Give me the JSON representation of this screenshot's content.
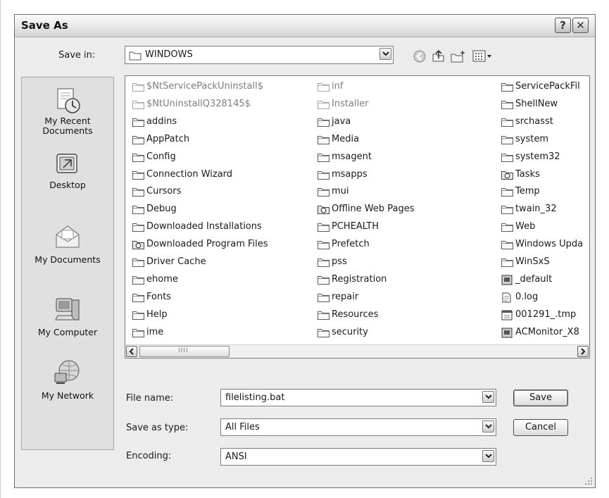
{
  "window": {
    "title": "Save As",
    "help_label": "?",
    "close_label": "✕"
  },
  "save_in": {
    "label": "Save in:",
    "value": "WINDOWS"
  },
  "toolbar": {
    "icons": [
      "back-icon",
      "up-folder-icon",
      "new-folder-icon",
      "views-menu-icon"
    ]
  },
  "places": [
    {
      "label": "My Recent Documents",
      "icon": "recent-documents-icon"
    },
    {
      "label": "Desktop",
      "icon": "desktop-icon"
    },
    {
      "label": "My Documents",
      "icon": "my-documents-icon"
    },
    {
      "label": "My Computer",
      "icon": "my-computer-icon"
    },
    {
      "label": "My Network",
      "icon": "my-network-icon"
    }
  ],
  "files": {
    "col1": [
      {
        "name": "$NtServicePackUninstall$",
        "type": "folder",
        "dim": true
      },
      {
        "name": "$NtUninstallQ328145$",
        "type": "folder",
        "dim": true
      },
      {
        "name": "addins",
        "type": "folder"
      },
      {
        "name": "AppPatch",
        "type": "folder"
      },
      {
        "name": "Config",
        "type": "folder"
      },
      {
        "name": "Connection Wizard",
        "type": "folder"
      },
      {
        "name": "Cursors",
        "type": "folder"
      },
      {
        "name": "Debug",
        "type": "folder"
      },
      {
        "name": "Downloaded Installations",
        "type": "folder"
      },
      {
        "name": "Downloaded Program Files",
        "type": "special"
      },
      {
        "name": "Driver Cache",
        "type": "folder"
      },
      {
        "name": "ehome",
        "type": "folder"
      },
      {
        "name": "Fonts",
        "type": "folder"
      },
      {
        "name": "Help",
        "type": "folder"
      },
      {
        "name": "ime",
        "type": "folder"
      }
    ],
    "col2": [
      {
        "name": "inf",
        "type": "folder",
        "dim": true
      },
      {
        "name": "Installer",
        "type": "folder",
        "dim": true
      },
      {
        "name": "java",
        "type": "folder"
      },
      {
        "name": "Media",
        "type": "folder"
      },
      {
        "name": "msagent",
        "type": "folder"
      },
      {
        "name": "msapps",
        "type": "folder"
      },
      {
        "name": "mui",
        "type": "folder"
      },
      {
        "name": "Offline Web Pages",
        "type": "special"
      },
      {
        "name": "PCHEALTH",
        "type": "folder"
      },
      {
        "name": "Prefetch",
        "type": "folder"
      },
      {
        "name": "pss",
        "type": "folder"
      },
      {
        "name": "Registration",
        "type": "folder"
      },
      {
        "name": "repair",
        "type": "folder"
      },
      {
        "name": "Resources",
        "type": "folder"
      },
      {
        "name": "security",
        "type": "folder"
      }
    ],
    "col3": [
      {
        "name": "ServicePackFil",
        "type": "folder"
      },
      {
        "name": "ShellNew",
        "type": "folder"
      },
      {
        "name": "srchasst",
        "type": "folder"
      },
      {
        "name": "system",
        "type": "folder"
      },
      {
        "name": "system32",
        "type": "folder"
      },
      {
        "name": "Tasks",
        "type": "special"
      },
      {
        "name": "Temp",
        "type": "folder"
      },
      {
        "name": "twain_32",
        "type": "folder"
      },
      {
        "name": "Web",
        "type": "folder"
      },
      {
        "name": "Windows Upda",
        "type": "folder"
      },
      {
        "name": "WinSxS",
        "type": "folder"
      },
      {
        "name": "_default",
        "type": "app"
      },
      {
        "name": "0.log",
        "type": "doc"
      },
      {
        "name": "001291_.tmp",
        "type": "tmp"
      },
      {
        "name": "ACMonitor_X8",
        "type": "app"
      }
    ]
  },
  "scrollbar": {
    "thumb_grip": "IIII"
  },
  "form": {
    "file_name_label": "File name:",
    "file_name_value": "filelisting.bat",
    "save_type_label": "Save as type:",
    "save_type_value": "All Files",
    "encoding_label": "Encoding:",
    "encoding_value": "ANSI"
  },
  "buttons": {
    "save_label": "Save",
    "cancel_label": "Cancel"
  }
}
